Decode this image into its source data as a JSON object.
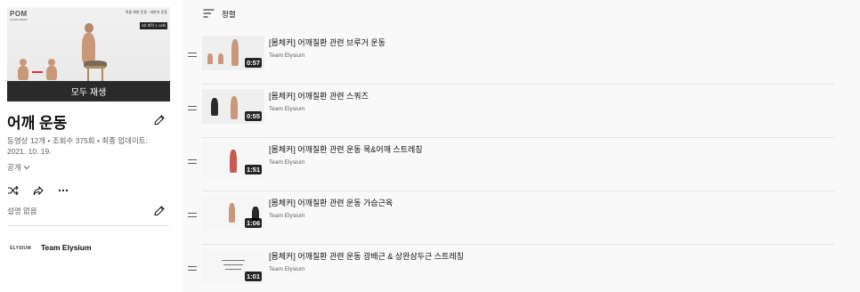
{
  "playlist": {
    "title": "어깨 운동",
    "thumbnail": {
      "brand": "POM",
      "brand_sub": "CLINIC WEAR",
      "caption_line1": "목을 위한 운동 : 바른자 운동",
      "caption_line2": "3호 최적 X 10회",
      "play_all_label": "모두 재생"
    },
    "stats": "동영상 12개 • 조회수 375회 • 최종 업데이트: 2021. 10. 19.",
    "privacy": "공개",
    "description": "설명 없음",
    "owner": {
      "name": "Team Elysium",
      "avatar_text": "ELYSIUM"
    }
  },
  "sort": {
    "label": "정렬",
    "icon": "sort-icon"
  },
  "videos": [
    {
      "title": "[몸체커] 어깨질환 관련 브루거 운동",
      "channel": "Team Elysium",
      "duration": "0:57"
    },
    {
      "title": "[몸체커] 어깨질환 관련 스쿼즈",
      "channel": "Team Elysium",
      "duration": "0:55"
    },
    {
      "title": "[몸체커] 어깨질환 관련 운동 목&어깨 스트레칭",
      "channel": "Team Elysium",
      "duration": "1:51"
    },
    {
      "title": "[몸체커] 어깨질환 관련 운동 가슴근육",
      "channel": "Team Elysium",
      "duration": "1:06"
    },
    {
      "title": "[몸체커] 어깨질환 관련 운동 광배근 & 상완삼두근 스트레칭",
      "channel": "Team Elysium",
      "duration": "1:01"
    }
  ],
  "colors": {
    "background": "#f9f9f9",
    "sidebar": "#ffffff",
    "text": "#0f0f0f",
    "secondary": "#606060"
  }
}
